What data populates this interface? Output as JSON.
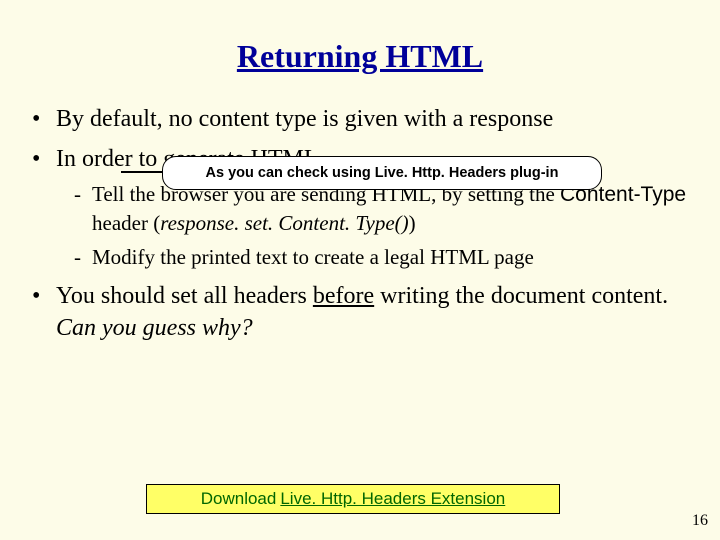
{
  "title": "Returning HTML",
  "bullets": {
    "b1": "By default, no content type is given with a response",
    "b2": "In order to generate HTML",
    "b2_sub1_pre": "Tell the browser you are sending HTML, by setting the ",
    "b2_sub1_ct": "Content-Type",
    "b2_sub1_mid": " header (",
    "b2_sub1_code": "response. set. Content. Type()",
    "b2_sub1_post": ")",
    "b2_sub2": "Modify the printed text to create a legal HTML page",
    "b3_pre": "You should set all headers ",
    "b3_under": "before",
    "b3_mid": " writing the document content. ",
    "b3_italic": "Can you guess why?"
  },
  "callout": "As you can check using Live. Http. Headers plug-in",
  "download": {
    "prefix": "Download",
    "link": "Live. Http. Headers Extension"
  },
  "page": "16"
}
